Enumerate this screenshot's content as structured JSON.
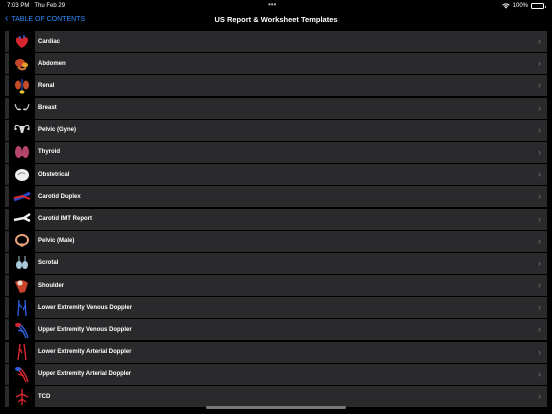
{
  "status": {
    "time": "7:03 PM",
    "date": "Thu Feb 29",
    "battery": "100%"
  },
  "nav": {
    "back_label": "TABLE OF CONTENTS",
    "title": "US Report & Worksheet Templates"
  },
  "items": [
    {
      "label": "Cardiac",
      "icon": "heart-icon",
      "color": "#d7262f"
    },
    {
      "label": "Abdomen",
      "icon": "abdomen-icon",
      "color": "#c8452c"
    },
    {
      "label": "Renal",
      "icon": "kidney-icon",
      "color": "#c44a2a"
    },
    {
      "label": "Breast",
      "icon": "breast-icon",
      "color": "#e0e0e0"
    },
    {
      "label": "Pelvic (Gyne)",
      "icon": "uterus-icon",
      "color": "#d9d9d9"
    },
    {
      "label": "Thyroid",
      "icon": "thyroid-icon",
      "color": "#b5456b"
    },
    {
      "label": "Obstetrical",
      "icon": "fetus-icon",
      "color": "#eeeeee"
    },
    {
      "label": "Carotid Duplex",
      "icon": "carotid-icon",
      "color": "#2b48c8"
    },
    {
      "label": "Carotid IMT Report",
      "icon": "carotid-imt-icon",
      "color": "#eeeeee"
    },
    {
      "label": "Pelvic (Male)",
      "icon": "male-pelvis-icon",
      "color": "#e7a07a"
    },
    {
      "label": "Scrotal",
      "icon": "scrotum-icon",
      "color": "#a9c9d9"
    },
    {
      "label": "Shoulder",
      "icon": "shoulder-icon",
      "color": "#c8452c"
    },
    {
      "label": "Lower Extremity Venous Doppler",
      "icon": "leg-veins-icon",
      "color": "#2b5fd8"
    },
    {
      "label": "Upper Extremity Venous Doppler",
      "icon": "arm-veins-icon",
      "color": "#2b5fd8"
    },
    {
      "label": "Lower Extremity Arterial Doppler",
      "icon": "leg-arteries-icon",
      "color": "#d7262f"
    },
    {
      "label": "Upper Extremity Arterial Doppler",
      "icon": "arm-arteries-icon",
      "color": "#d7262f"
    },
    {
      "label": "TCD",
      "icon": "brain-vessels-icon",
      "color": "#d7262f"
    }
  ]
}
